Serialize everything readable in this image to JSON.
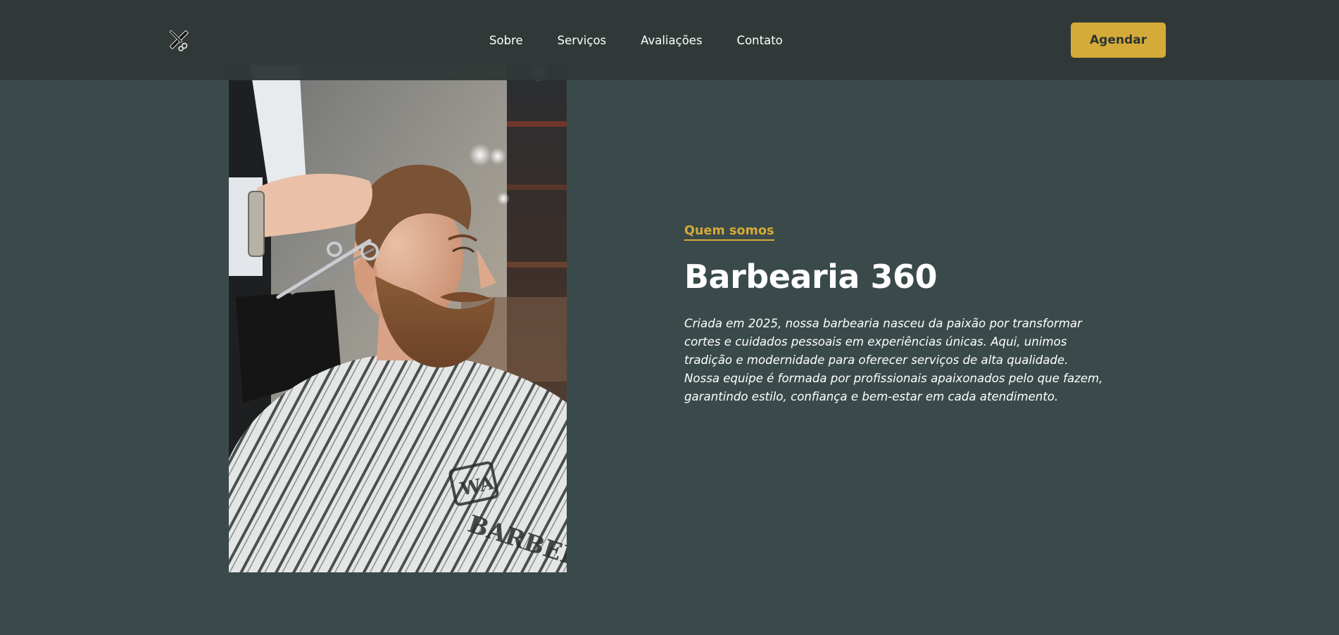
{
  "header": {
    "logo_icon": "barber-scissors-comb-icon",
    "nav": [
      {
        "label": "Sobre"
      },
      {
        "label": "Serviços"
      },
      {
        "label": "Avaliações"
      },
      {
        "label": "Contato"
      }
    ],
    "cta_label": "Agendar"
  },
  "about": {
    "eyebrow": "Quem somos",
    "title": "Barbearia 360",
    "description": "Criada em 2025, nossa barbearia nasceu da paixão por transformar cortes e cuidados pessoais em experiências únicas. Aqui, unimos tradição e modernidade para oferecer serviços de alta qualidade. Nossa equipe é formada por profissionais apaixonados pelo que fazem, garantindo estilo, confiança e bem-estar em cada atendimento.",
    "photo_cape_lettering": [
      "WA",
      "BARBER"
    ]
  },
  "colors": {
    "background": "#3a4a4a",
    "header": "#313938",
    "accent": "#d4ab38",
    "text": "#ffffff"
  }
}
